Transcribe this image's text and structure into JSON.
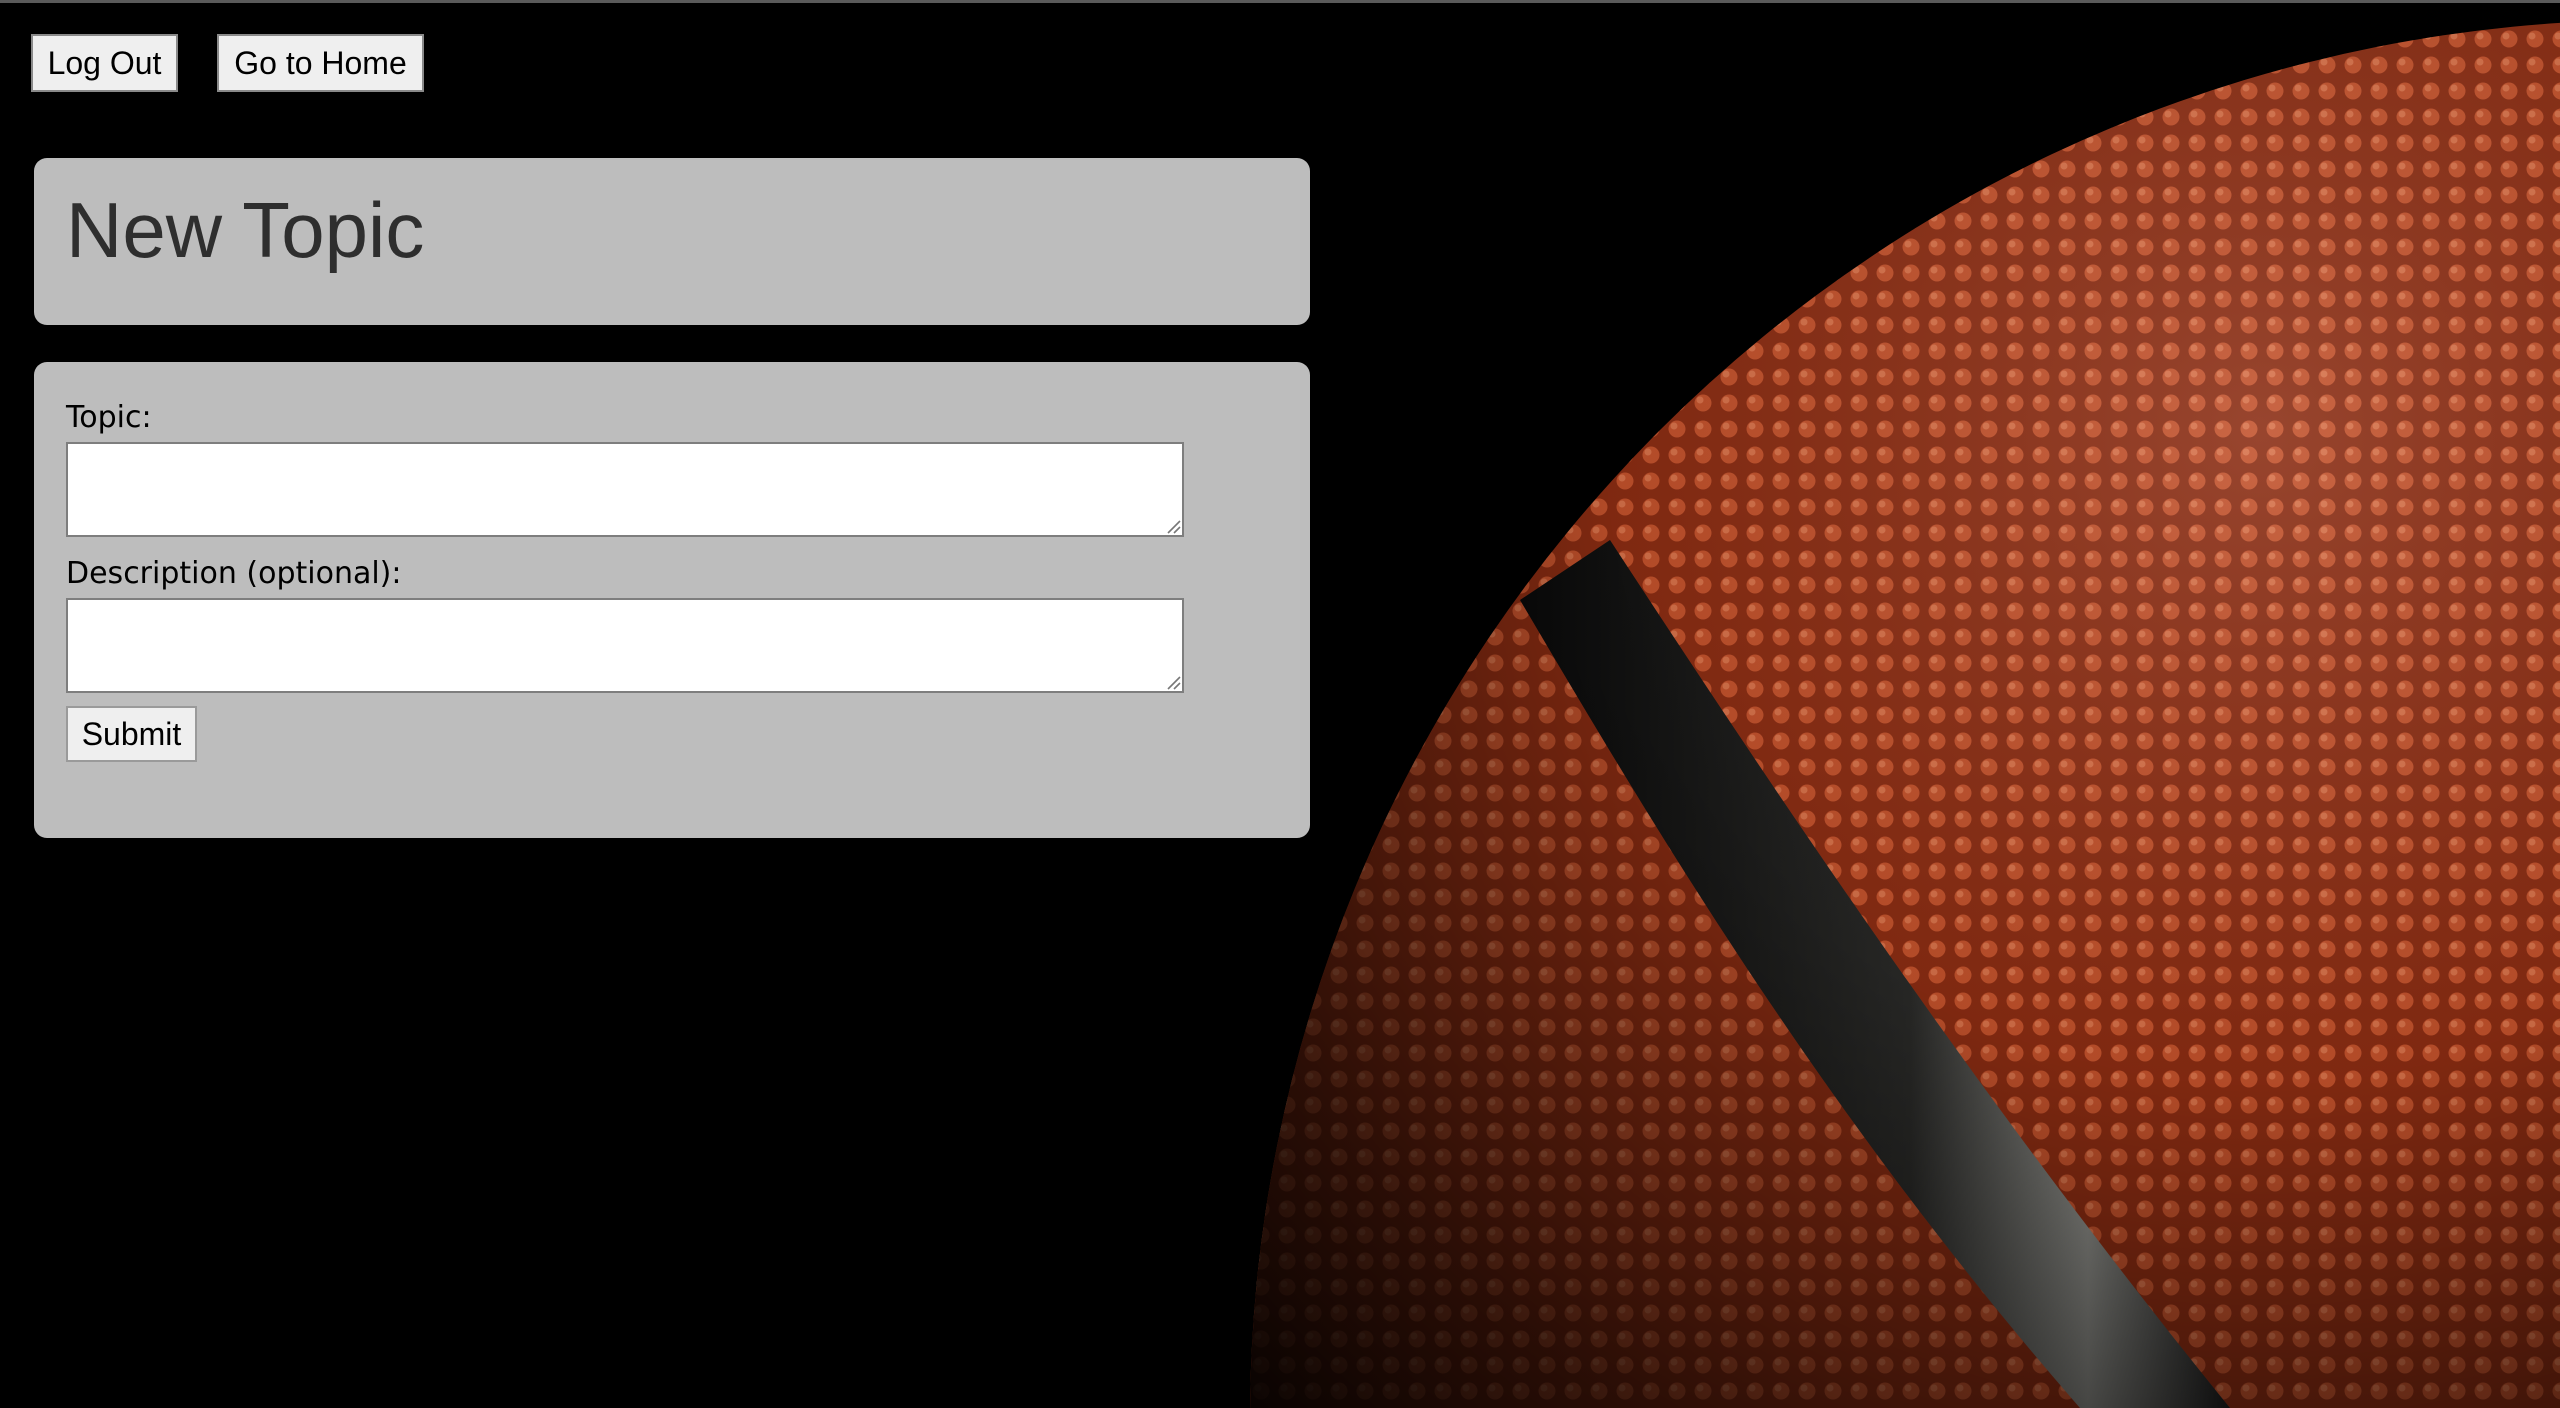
{
  "header": {
    "logout_label": "Log Out",
    "home_label": "Go to Home"
  },
  "page": {
    "title": "New Topic"
  },
  "form": {
    "topic_label": "Topic:",
    "topic_value": "",
    "description_label": "Description (optional):",
    "description_value": "",
    "submit_label": "Submit"
  },
  "colors": {
    "background": "#000000",
    "panel": "#bdbdbd",
    "ball": "#b0401f"
  },
  "icons": {
    "background_image": "basketball-photo",
    "resize": "resize-grip-icon"
  }
}
